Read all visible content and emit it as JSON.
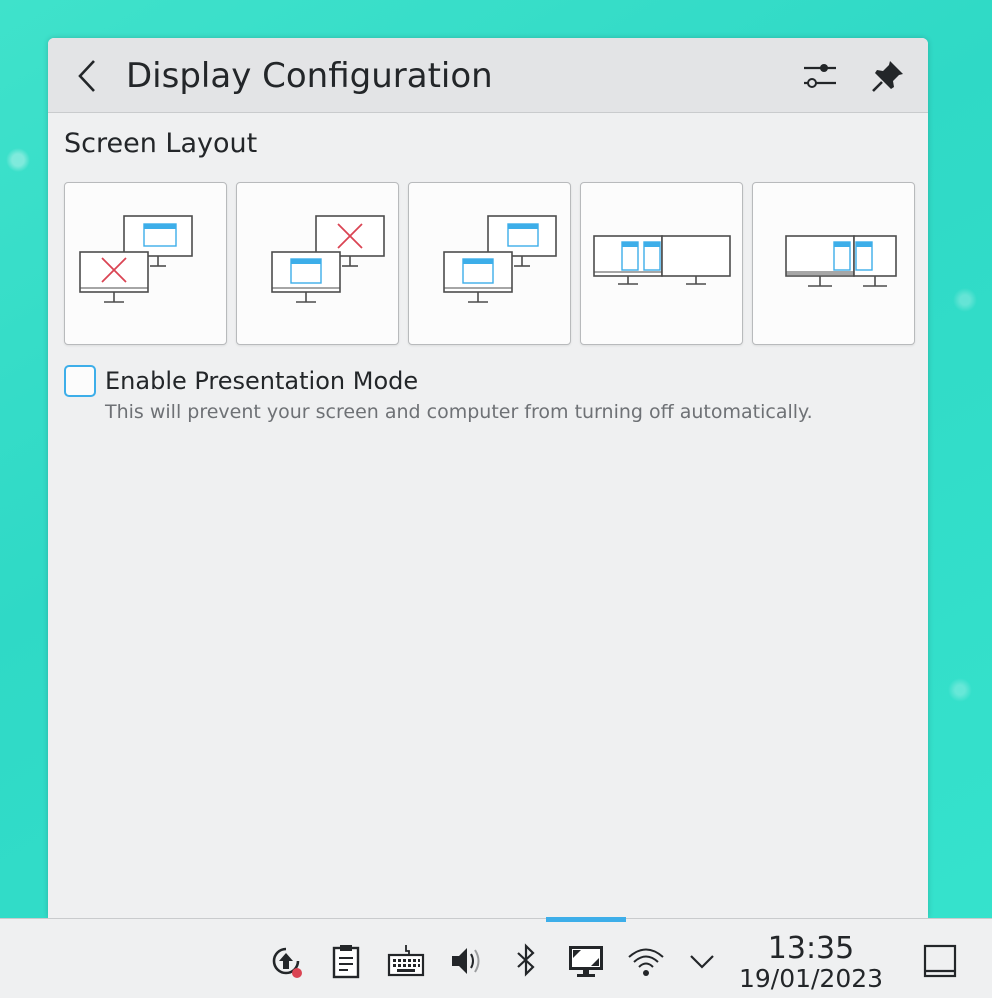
{
  "popup": {
    "title": "Display Configuration",
    "back_icon": "chevron-left-icon",
    "configure_icon": "sliders-icon",
    "pin_icon": "pin-icon"
  },
  "screen_layout": {
    "title": "Screen Layout",
    "options": [
      {
        "id": "external-only",
        "icon": "external-only-icon"
      },
      {
        "id": "laptop-only",
        "icon": "laptop-only-icon"
      },
      {
        "id": "mirror",
        "icon": "mirror-icon"
      },
      {
        "id": "extend-left",
        "icon": "extend-left-icon"
      },
      {
        "id": "extend-right",
        "icon": "extend-right-icon"
      }
    ]
  },
  "presentation": {
    "label": "Enable Presentation Mode",
    "description": "This will prevent your screen and computer from turning off automatically.",
    "checked": false
  },
  "taskbar": {
    "clock_time": "13:35",
    "clock_date": "19/01/2023",
    "accent": "#3daee9",
    "notification_color": "#da4453"
  },
  "colors": {
    "accent": "#3daee9",
    "error": "#da4453",
    "background": "#37dec8"
  }
}
